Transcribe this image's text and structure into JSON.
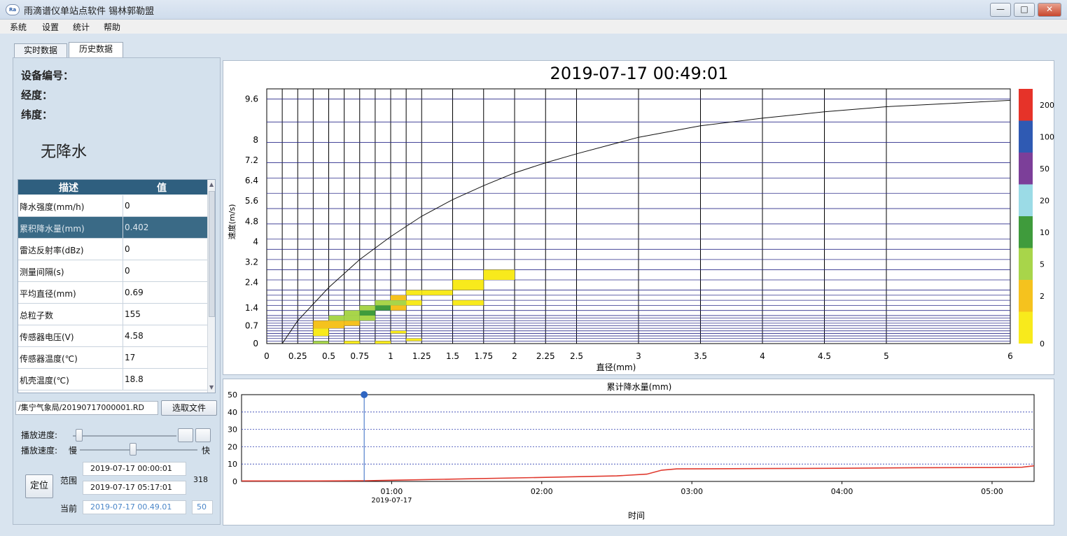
{
  "window": {
    "icon_label": "Ra",
    "title": "雨滴谱仪单站点软件  锡林郭勒盟",
    "min_label": "—",
    "max_label": "□",
    "close_label": "✕"
  },
  "menu": [
    "系统",
    "设置",
    "统计",
    "帮助"
  ],
  "tabs": [
    {
      "label": "实时数据",
      "active": false
    },
    {
      "label": "历史数据",
      "active": true
    }
  ],
  "station": {
    "device_label": "设备编号：",
    "lon_label": "经度：",
    "lat_label": "纬度：",
    "precip_status": "无降水"
  },
  "table": {
    "headers": [
      "描述",
      "值"
    ],
    "rows": [
      {
        "desc": "降水强度(mm/h)",
        "value": "0",
        "selected": false
      },
      {
        "desc": "累积降水量(mm)",
        "value": "0.402",
        "selected": true
      },
      {
        "desc": "雷达反射率(dBz)",
        "value": "0",
        "selected": false
      },
      {
        "desc": "测量间隔(s)",
        "value": "0",
        "selected": false
      },
      {
        "desc": "平均直径(mm)",
        "value": "0.69",
        "selected": false
      },
      {
        "desc": "总粒子数",
        "value": "155",
        "selected": false
      },
      {
        "desc": "传感器电压(V)",
        "value": "4.58",
        "selected": false
      },
      {
        "desc": "传感器温度(℃)",
        "value": "17",
        "selected": false
      },
      {
        "desc": "机壳温度(℃)",
        "value": "18.8",
        "selected": false
      }
    ]
  },
  "file": {
    "path": "/集宁气象局/20190717000001.RD",
    "select_button": "选取文件"
  },
  "playback": {
    "progress_label": "播放进度:",
    "speed_label": "播放速度:",
    "slow_label": "慢",
    "fast_label": "快",
    "progress_value": 0.06,
    "speed_value": 0.45
  },
  "range": {
    "locate_button": "定位",
    "range_label": "范围",
    "start": "2019-07-17 00:00:01",
    "end": "2019-07-17 05:17:01",
    "count": "318",
    "current_label": "当前",
    "current": "2019-07-17 00.49.01",
    "current_index": "50"
  },
  "chart_data": [
    {
      "type": "heatmap",
      "title": "2019-07-17  00:49:01",
      "xlabel": "直径(mm)",
      "ylabel": "速度(m/s)",
      "xlim": [
        0,
        6
      ],
      "ylim": [
        0,
        10
      ],
      "x_ticks": [
        "0",
        "0.25",
        "0.5",
        "0.75",
        "1",
        "1.25",
        "1.5",
        "1.75",
        "2",
        "2.25",
        "2.5",
        "3",
        "3.5",
        "4",
        "4.5",
        "5",
        "6"
      ],
      "y_ticks": [
        "0",
        "0.7",
        "1.4",
        "2.4",
        "3.2",
        "4",
        "4.8",
        "5.6",
        "6.4",
        "7.2",
        "8",
        "9.6"
      ],
      "colorbar": {
        "labels": [
          "0",
          "2",
          "5",
          "10",
          "20",
          "50",
          "100",
          "200"
        ],
        "colors": [
          "#f8ea1c",
          "#f5c21e",
          "#a8d54a",
          "#3f9b3c",
          "#9bdbe6",
          "#7c3f99",
          "#2f5ab3",
          "#e63329"
        ]
      },
      "cells": [
        {
          "x": [
            0.375,
            0.5
          ],
          "y": [
            0.6,
            0.9
          ],
          "level": 1
        },
        {
          "x": [
            0.5,
            0.625
          ],
          "y": [
            0.6,
            0.9
          ],
          "level": 1
        },
        {
          "x": [
            0.375,
            0.5
          ],
          "y": [
            0.3,
            0.6
          ],
          "level": 0
        },
        {
          "x": [
            0.5,
            0.625
          ],
          "y": [
            0.9,
            1.1
          ],
          "level": 2
        },
        {
          "x": [
            0.625,
            0.75
          ],
          "y": [
            0.7,
            0.9
          ],
          "level": 1
        },
        {
          "x": [
            0.625,
            0.75
          ],
          "y": [
            0.9,
            1.1
          ],
          "level": 2
        },
        {
          "x": [
            0.625,
            0.75
          ],
          "y": [
            1.1,
            1.3
          ],
          "level": 2
        },
        {
          "x": [
            0.75,
            0.875
          ],
          "y": [
            1.1,
            1.3
          ],
          "level": 3
        },
        {
          "x": [
            0.75,
            0.875
          ],
          "y": [
            0.9,
            1.1
          ],
          "level": 2
        },
        {
          "x": [
            0.75,
            0.875
          ],
          "y": [
            1.3,
            1.5
          ],
          "level": 2
        },
        {
          "x": [
            0.875,
            1.0
          ],
          "y": [
            1.3,
            1.5
          ],
          "level": 3
        },
        {
          "x": [
            0.875,
            1.0
          ],
          "y": [
            1.5,
            1.7
          ],
          "level": 2
        },
        {
          "x": [
            1.0,
            1.125
          ],
          "y": [
            1.5,
            1.7
          ],
          "level": 2
        },
        {
          "x": [
            1.0,
            1.125
          ],
          "y": [
            1.3,
            1.5
          ],
          "level": 1
        },
        {
          "x": [
            1.0,
            1.125
          ],
          "y": [
            1.7,
            1.9
          ],
          "level": 1
        },
        {
          "x": [
            1.125,
            1.25
          ],
          "y": [
            1.9,
            2.1
          ],
          "level": 0
        },
        {
          "x": [
            1.125,
            1.25
          ],
          "y": [
            1.5,
            1.7
          ],
          "level": 0
        },
        {
          "x": [
            1.25,
            1.5
          ],
          "y": [
            1.9,
            2.1
          ],
          "level": 0
        },
        {
          "x": [
            1.5,
            1.75
          ],
          "y": [
            2.1,
            2.5
          ],
          "level": 0
        },
        {
          "x": [
            1.5,
            1.75
          ],
          "y": [
            1.5,
            1.7
          ],
          "level": 0
        },
        {
          "x": [
            1.75,
            2.0
          ],
          "y": [
            2.5,
            2.9
          ],
          "level": 0
        },
        {
          "x": [
            0.375,
            0.5
          ],
          "y": [
            0.0,
            0.1
          ],
          "level": 2
        },
        {
          "x": [
            0.625,
            0.75
          ],
          "y": [
            0.0,
            0.1
          ],
          "level": 0
        },
        {
          "x": [
            0.875,
            1.0
          ],
          "y": [
            0.0,
            0.1
          ],
          "level": 0
        },
        {
          "x": [
            1.0,
            1.125
          ],
          "y": [
            0.4,
            0.5
          ],
          "level": 0
        },
        {
          "x": [
            1.125,
            1.25
          ],
          "y": [
            0.1,
            0.2
          ],
          "level": 0
        }
      ],
      "fall_curve": {
        "x": [
          0.125,
          0.25,
          0.5,
          0.75,
          1.0,
          1.25,
          1.5,
          1.75,
          2.0,
          2.25,
          2.5,
          3.0,
          3.5,
          4.0,
          4.5,
          5.0,
          6.0
        ],
        "y": [
          0.0,
          0.9,
          2.2,
          3.3,
          4.2,
          5.0,
          5.65,
          6.2,
          6.7,
          7.1,
          7.45,
          8.1,
          8.55,
          8.85,
          9.1,
          9.3,
          9.55
        ]
      }
    },
    {
      "type": "line",
      "title": "累计降水量(mm)",
      "xlabel": "时间",
      "ylabel": "",
      "ylim": [
        0,
        50
      ],
      "y_ticks": [
        "0",
        "10",
        "20",
        "30",
        "40",
        "50"
      ],
      "x_ticks": [
        {
          "t": 1.0,
          "label": "01:00",
          "sub": "2019-07-17"
        },
        {
          "t": 2.0,
          "label": "02:00",
          "sub": ""
        },
        {
          "t": 3.0,
          "label": "03:00",
          "sub": ""
        },
        {
          "t": 4.0,
          "label": "04:00",
          "sub": ""
        },
        {
          "t": 5.0,
          "label": "05:00",
          "sub": ""
        }
      ],
      "xlim": [
        0.0,
        5.28
      ],
      "marker_t": 0.817,
      "series": [
        {
          "values": [
            [
              0,
              0.3
            ],
            [
              0.5,
              0.3
            ],
            [
              0.82,
              0.4
            ],
            [
              1.0,
              0.7
            ],
            [
              1.5,
              1.5
            ],
            [
              2.0,
              2.3
            ],
            [
              2.5,
              3.2
            ],
            [
              2.7,
              4.2
            ],
            [
              2.8,
              6.5
            ],
            [
              2.9,
              7.2
            ],
            [
              3.5,
              7.4
            ],
            [
              4.0,
              7.6
            ],
            [
              4.5,
              7.9
            ],
            [
              5.0,
              8.0
            ],
            [
              5.2,
              8.2
            ],
            [
              5.28,
              9.0
            ]
          ]
        }
      ]
    }
  ],
  "colors": {
    "grid": "#000000",
    "curve": "#111111",
    "line_series": "#e03a2f",
    "marker": "#2f66c2",
    "hgrid_blue": "#2f3fb0"
  }
}
